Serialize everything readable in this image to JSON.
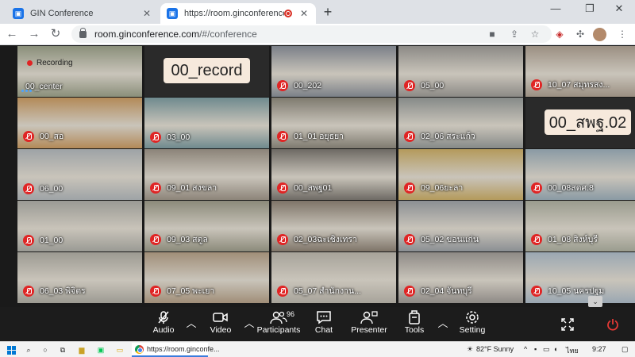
{
  "browser": {
    "tabs": [
      {
        "title": "GIN Conference",
        "active": false
      },
      {
        "title": "https://room.ginconference.com/#/en",
        "active": true,
        "recording": true
      }
    ],
    "url_host": "room.ginconference.com",
    "url_rest": "/#/conference",
    "new_tab_symbol": "+"
  },
  "conference": {
    "recording_label": "Recording",
    "tiles": [
      {
        "label": "00_center",
        "muted": false,
        "speaking": true,
        "type": "video",
        "bg": "#8a8f7a"
      },
      {
        "label": "00_record",
        "muted": true,
        "type": "name"
      },
      {
        "label": "00_202",
        "muted": true,
        "type": "video",
        "bg": "#7b8088"
      },
      {
        "label": "05_00",
        "muted": true,
        "type": "video",
        "bg": "#8c8a86"
      },
      {
        "label": "10_07 สมุทรสง...",
        "muted": true,
        "type": "video",
        "bg": "#9b8f82"
      },
      {
        "label": "00_สอ",
        "muted": true,
        "type": "video",
        "bg": "#b38a58"
      },
      {
        "label": "03_00",
        "muted": true,
        "type": "video",
        "bg": "#6f8a8e"
      },
      {
        "label": "01_01 อยุธยา",
        "muted": true,
        "type": "video",
        "bg": "#7e7a6f"
      },
      {
        "label": "02_06 สระแก้ว",
        "muted": true,
        "type": "video",
        "bg": "#868a88"
      },
      {
        "label": "00_สพฐ.02",
        "muted": true,
        "type": "name"
      },
      {
        "label": "06_00",
        "muted": true,
        "type": "video",
        "bg": "#9ea3a6"
      },
      {
        "label": "09_01 สงขลา",
        "muted": true,
        "type": "video",
        "bg": "#8c8479"
      },
      {
        "label": "00_สพฐ01",
        "muted": true,
        "type": "video",
        "bg": "#6e6a64"
      },
      {
        "label": "09_06ยะลา",
        "muted": true,
        "type": "video",
        "bg": "#b49a5c"
      },
      {
        "label": "00_08สตศ.8",
        "muted": true,
        "type": "video",
        "bg": "#8a9aa4"
      },
      {
        "label": "01_00",
        "muted": true,
        "type": "video",
        "bg": "#9a9a94"
      },
      {
        "label": "09_03 สตูล",
        "muted": true,
        "type": "video",
        "bg": "#8b8a7a"
      },
      {
        "label": "02_03ฉะเชิงเทรา",
        "muted": true,
        "type": "video",
        "bg": "#7e7468"
      },
      {
        "label": "05_02 ขอนแก่น",
        "muted": true,
        "type": "video",
        "bg": "#8b8f93"
      },
      {
        "label": "01_08 สิงห์บุรี",
        "muted": true,
        "type": "video",
        "bg": "#9a9c8e"
      },
      {
        "label": "06_03 พิจิตร",
        "muted": true,
        "type": "video",
        "bg": "#9c9a92"
      },
      {
        "label": "07_05 พะเยา",
        "muted": true,
        "type": "video",
        "bg": "#a08e78"
      },
      {
        "label": "05_07 สำนักงาน...",
        "muted": true,
        "type": "video",
        "bg": "#a7a39a"
      },
      {
        "label": "02_04 จันทบุรี",
        "muted": true,
        "type": "video",
        "bg": "#8e8a86"
      },
      {
        "label": "10_05 นครปฐม",
        "muted": true,
        "type": "video",
        "bg": "#9aa7b2"
      }
    ],
    "scroll_chevron": "⌄"
  },
  "controls": {
    "audio_label": "Audio",
    "video_label": "Video",
    "participants_label": "Participants",
    "participants_count": "96",
    "chat_label": "Chat",
    "presenter_label": "Presenter",
    "tools_label": "Tools",
    "setting_label": "Setting"
  },
  "taskbar": {
    "chrome_label": "https://room.ginconfe...",
    "weather": "82°F  Sunny",
    "language": "ไทย",
    "time": "9:27"
  }
}
